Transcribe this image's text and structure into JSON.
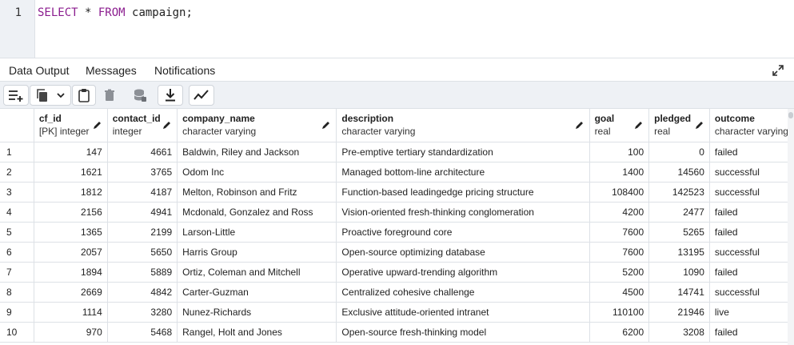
{
  "editor": {
    "line_number": "1",
    "code": {
      "kw1": "SELECT",
      "star": " * ",
      "kw2": "FROM",
      "rest": " campaign;"
    }
  },
  "tabs": [
    {
      "label": "Data Output",
      "active": true
    },
    {
      "label": "Messages",
      "active": false
    },
    {
      "label": "Notifications",
      "active": false
    }
  ],
  "toolbar_icons": [
    "add-row-icon",
    "copy-icon",
    "chevron-down-icon",
    "paste-icon",
    "delete-icon",
    "save-data-icon",
    "download-icon",
    "graph-icon"
  ],
  "columns": [
    {
      "name": "cf_id",
      "type": "[PK] integer"
    },
    {
      "name": "contact_id",
      "type": "integer"
    },
    {
      "name": "company_name",
      "type": "character varying"
    },
    {
      "name": "description",
      "type": "character varying"
    },
    {
      "name": "goal",
      "type": "real"
    },
    {
      "name": "pledged",
      "type": "real"
    },
    {
      "name": "outcome",
      "type": "character varying"
    }
  ],
  "rows": [
    [
      "1",
      "147",
      "4661",
      "Baldwin, Riley and Jackson",
      "Pre-emptive tertiary standardization",
      "100",
      "0",
      "failed"
    ],
    [
      "2",
      "1621",
      "3765",
      "Odom Inc",
      "Managed bottom-line architecture",
      "1400",
      "14560",
      "successful"
    ],
    [
      "3",
      "1812",
      "4187",
      "Melton, Robinson and Fritz",
      "Function-based leadingedge pricing structure",
      "108400",
      "142523",
      "successful"
    ],
    [
      "4",
      "2156",
      "4941",
      "Mcdonald, Gonzalez and Ross",
      "Vision-oriented fresh-thinking conglomeration",
      "4200",
      "2477",
      "failed"
    ],
    [
      "5",
      "1365",
      "2199",
      "Larson-Little",
      "Proactive foreground core",
      "7600",
      "5265",
      "failed"
    ],
    [
      "6",
      "2057",
      "5650",
      "Harris Group",
      "Open-source optimizing database",
      "7600",
      "13195",
      "successful"
    ],
    [
      "7",
      "1894",
      "5889",
      "Ortiz, Coleman and Mitchell",
      "Operative upward-trending algorithm",
      "5200",
      "1090",
      "failed"
    ],
    [
      "8",
      "2669",
      "4842",
      "Carter-Guzman",
      "Centralized cohesive challenge",
      "4500",
      "14741",
      "successful"
    ],
    [
      "9",
      "1114",
      "3280",
      "Nunez-Richards",
      "Exclusive attitude-oriented intranet",
      "110100",
      "21946",
      "live"
    ],
    [
      "10",
      "970",
      "5468",
      "Rangel, Holt and Jones",
      "Open-source fresh-thinking model",
      "6200",
      "3208",
      "failed"
    ]
  ],
  "colors": {
    "accent": "#3a6fb6",
    "keyword": "#8b1d8f",
    "toolbar_bg": "#eef1f5",
    "border": "#dde1e6"
  }
}
